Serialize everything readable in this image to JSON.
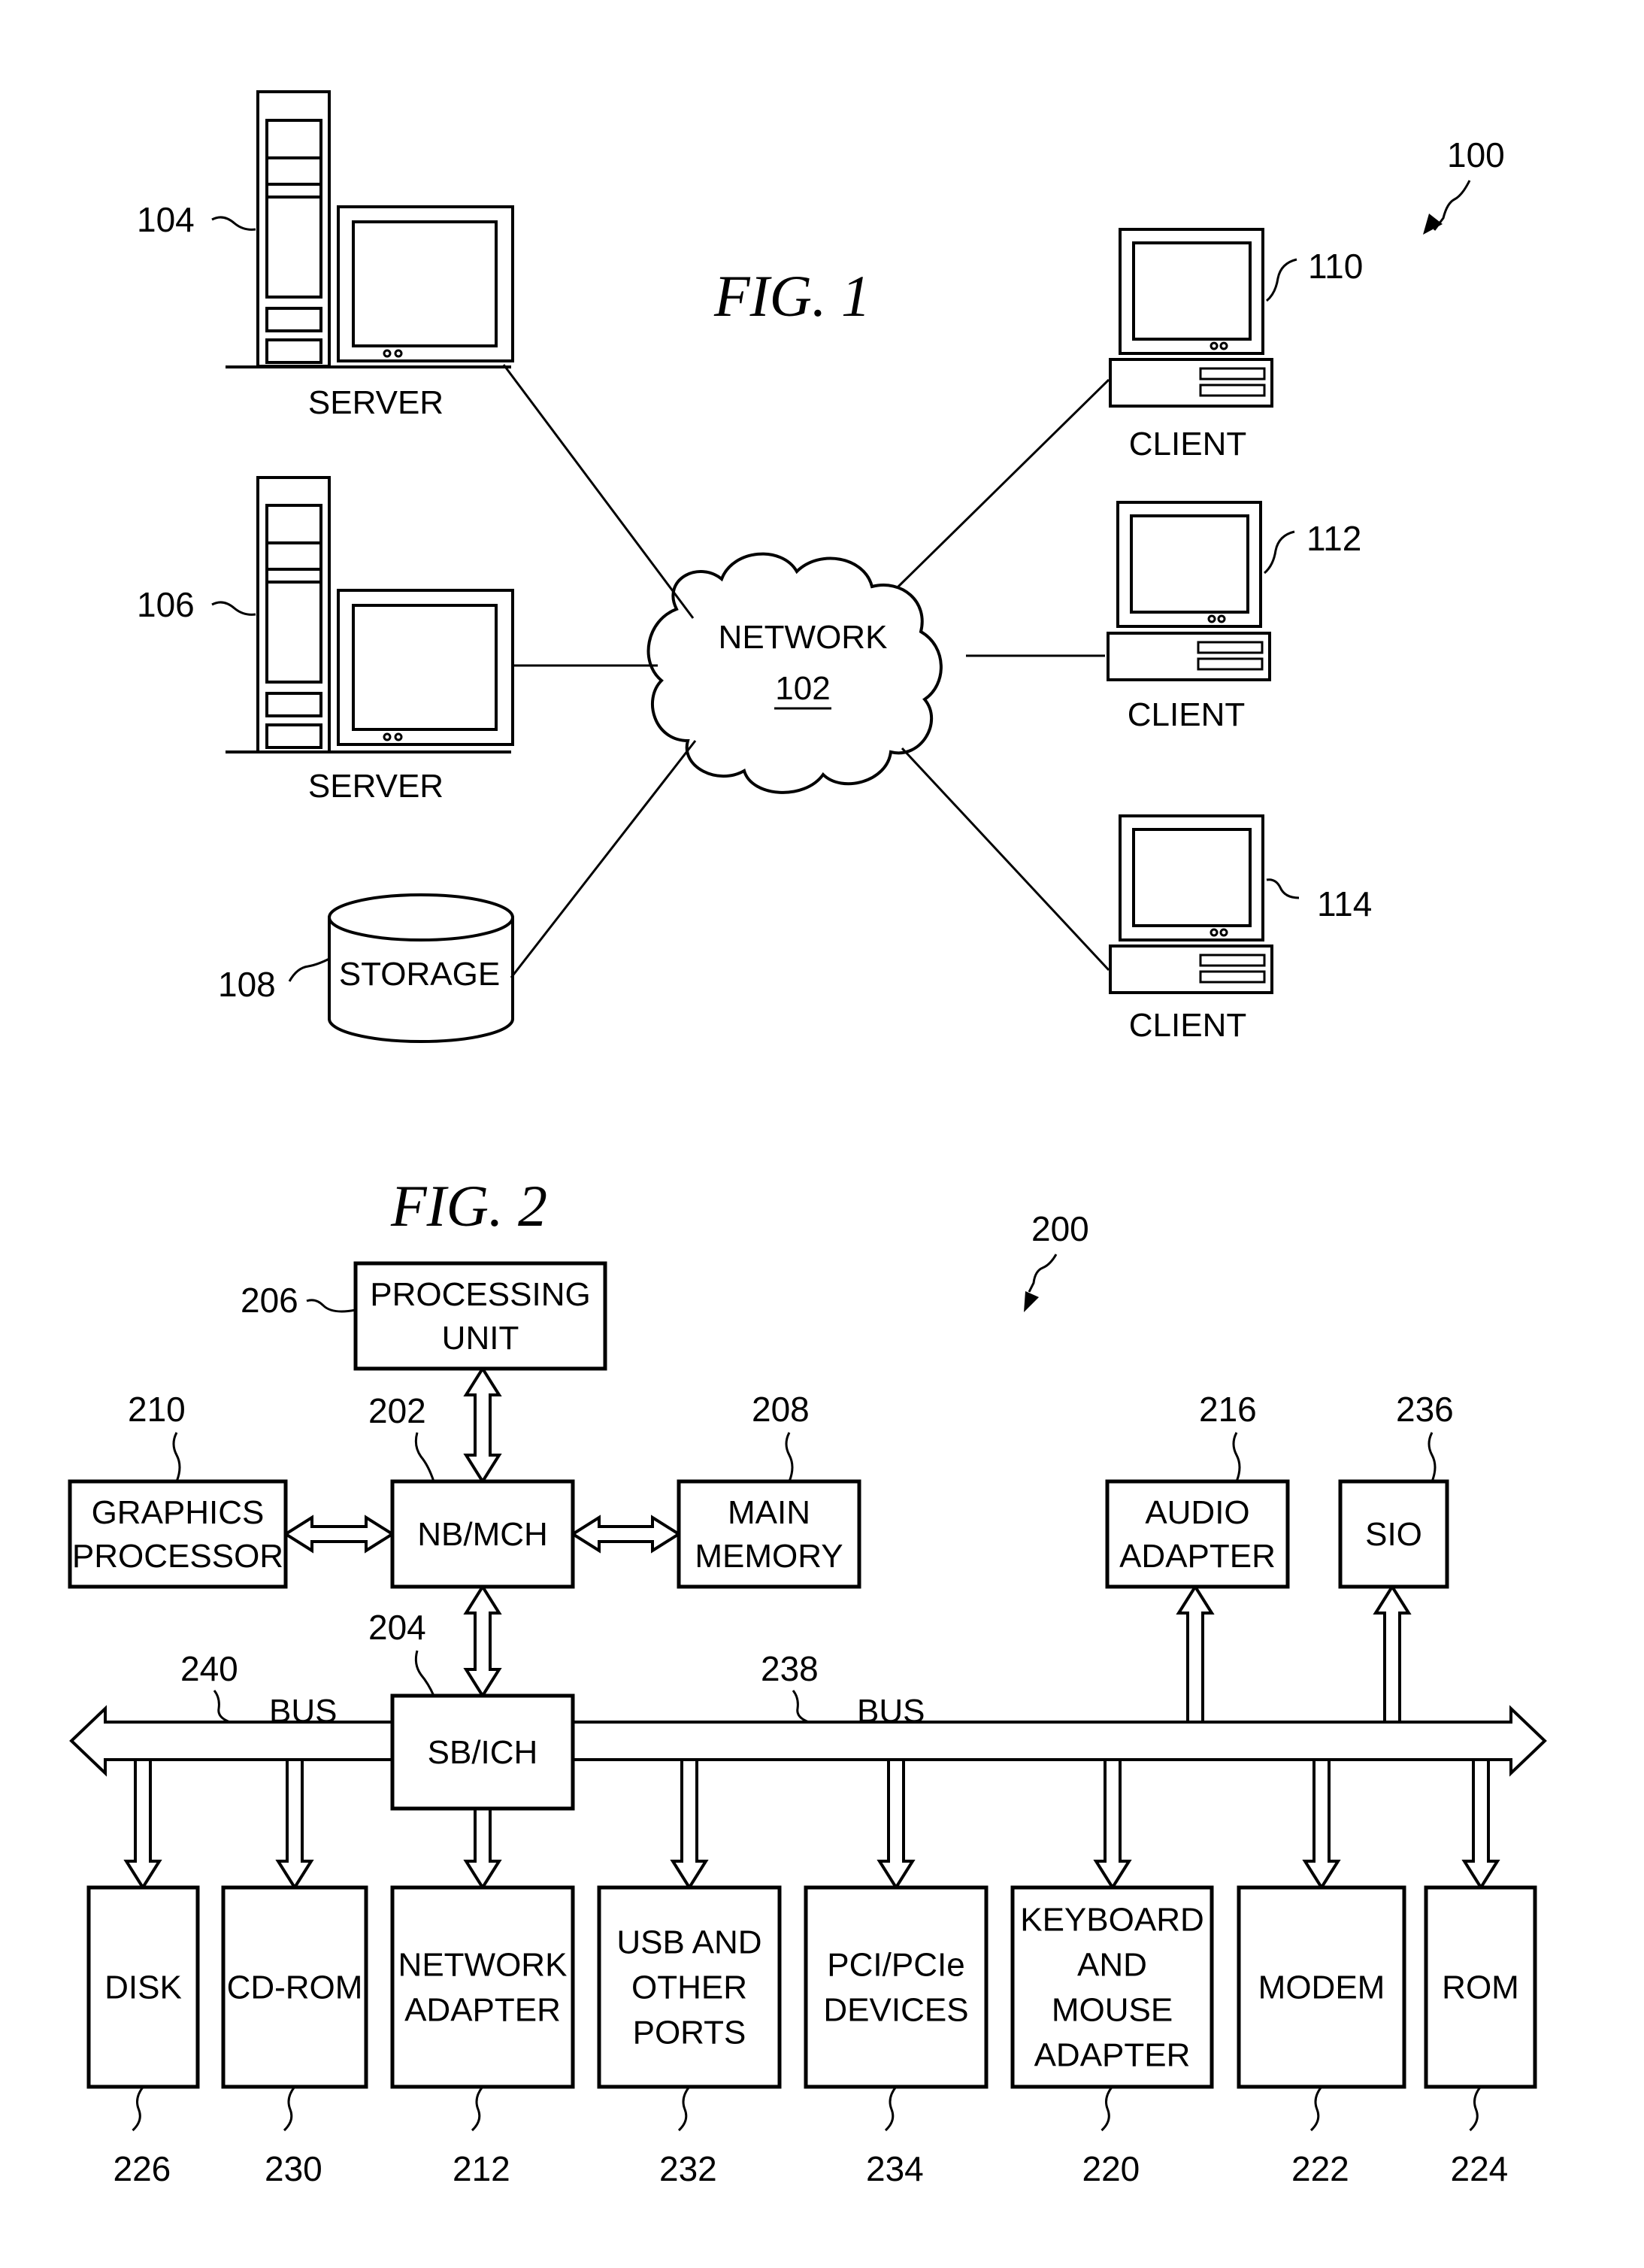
{
  "fig1": {
    "title": "FIG. 1",
    "ref": "100",
    "network": {
      "label": "NETWORK",
      "ref": "102"
    },
    "servers": [
      {
        "ref": "104",
        "label": "SERVER"
      },
      {
        "ref": "106",
        "label": "SERVER"
      }
    ],
    "storage": {
      "ref": "108",
      "label": "STORAGE"
    },
    "clients": [
      {
        "ref": "110",
        "label": "CLIENT"
      },
      {
        "ref": "112",
        "label": "CLIENT"
      },
      {
        "ref": "114",
        "label": "CLIENT"
      }
    ]
  },
  "fig2": {
    "title": "FIG. 2",
    "ref": "200",
    "processing_unit": {
      "ref": "206",
      "lines": [
        "PROCESSING",
        "UNIT"
      ]
    },
    "nb_mch": {
      "ref": "202",
      "lines": [
        "NB/MCH"
      ]
    },
    "graphics": {
      "ref": "210",
      "lines": [
        "GRAPHICS",
        "PROCESSOR"
      ]
    },
    "main_memory": {
      "ref": "208",
      "lines": [
        "MAIN",
        "MEMORY"
      ]
    },
    "audio": {
      "ref": "216",
      "lines": [
        "AUDIO",
        "ADAPTER"
      ]
    },
    "sio": {
      "ref": "236",
      "lines": [
        "SIO"
      ]
    },
    "sb_ich": {
      "ref": "204",
      "lines": [
        "SB/ICH"
      ]
    },
    "bus_left": {
      "ref": "240",
      "label": "BUS"
    },
    "bus_right": {
      "ref": "238",
      "label": "BUS"
    },
    "devices": [
      {
        "ref": "226",
        "lines": [
          "DISK"
        ]
      },
      {
        "ref": "230",
        "lines": [
          "CD-ROM"
        ]
      },
      {
        "ref": "212",
        "lines": [
          "NETWORK",
          "ADAPTER"
        ]
      },
      {
        "ref": "232",
        "lines": [
          "USB AND",
          "OTHER",
          "PORTS"
        ]
      },
      {
        "ref": "234",
        "lines": [
          "PCI/PCIe",
          "DEVICES"
        ]
      },
      {
        "ref": "220",
        "lines": [
          "KEYBOARD",
          "AND",
          "MOUSE",
          "ADAPTER"
        ]
      },
      {
        "ref": "222",
        "lines": [
          "MODEM"
        ]
      },
      {
        "ref": "224",
        "lines": [
          "ROM"
        ]
      }
    ]
  }
}
